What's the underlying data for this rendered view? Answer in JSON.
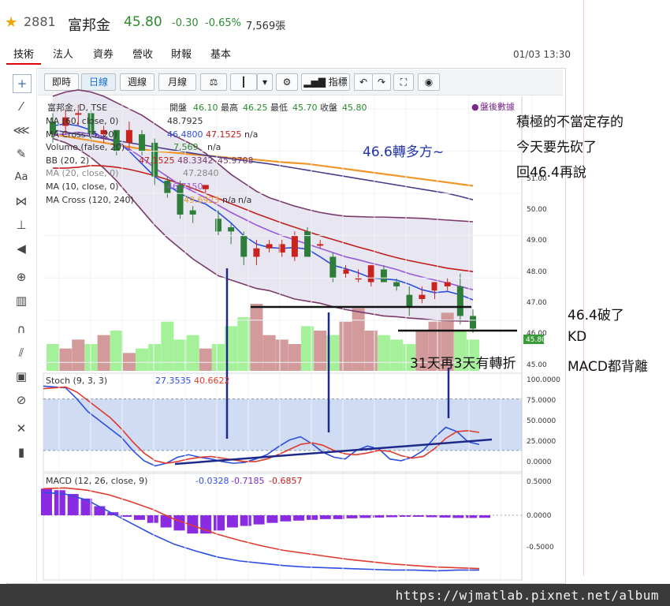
{
  "header": {
    "stock_code": "2881",
    "stock_name": "富邦金",
    "price": "45.80",
    "change": "-0.30",
    "change_pct": "-0.65%",
    "volume": "7,569張",
    "price_color": "#2e8b2e"
  },
  "tabs": [
    {
      "label": "技術",
      "active": true
    },
    {
      "label": "法人"
    },
    {
      "label": "資券"
    },
    {
      "label": "營收"
    },
    {
      "label": "財報"
    },
    {
      "label": "基本"
    }
  ],
  "timestamp": "01/03 13:30",
  "toolbar": {
    "realtime": "即時",
    "daily": "日線",
    "weekly": "週線",
    "monthly": "月線",
    "indicators": "指標"
  },
  "left_tools": [
    "crosshair-icon",
    "trend-line-icon",
    "fib-icon",
    "brush-icon",
    "text-icon",
    "pattern-icon",
    "measure-icon",
    "arrow-left-icon",
    "zoom-icon",
    "bars-icon",
    "magnet-icon",
    "ruler-icon",
    "lock-icon",
    "eye-off-icon",
    "wrench-icon",
    "trash-icon"
  ],
  "legend": {
    "main": {
      "name": "富邦金, D, TSE",
      "open_label": "開盤",
      "open": "46.10",
      "high_label": "最高",
      "high": "46.25",
      "low_label": "最低",
      "low": "45.70",
      "close_label": "收盤",
      "close": "45.80"
    },
    "after_hours": "盤後數據",
    "ma60": {
      "name": "MA (60, close, 0)",
      "value": "48.7925"
    },
    "macross520": {
      "name": "MA Cross (5, 20)",
      "v1": "46.4800",
      "v2": "47.1525",
      "v3": "n/a"
    },
    "volume": {
      "name": "Volume (false, 20)",
      "v1": "7,569",
      "v2": "n/a"
    },
    "bb": {
      "name": "BB (20, 2)",
      "v1": "47.1525",
      "v2": "48.3342",
      "v3": "45.9708"
    },
    "ma20": {
      "name": "MA (20, close, 0)",
      "value": "47.2840"
    },
    "ma10": {
      "name": "MA (10, close, 0)",
      "value": "46.7150"
    },
    "macross120240": {
      "name": "MA Cross (120, 240)",
      "v1": "49.6923",
      "v2": "n/a",
      "v3": "n/a"
    },
    "stoch": {
      "name": "Stoch (9, 3, 3)",
      "v1": "27.3535",
      "v2": "40.6622"
    },
    "macd": {
      "name": "MACD (12, 26, close, 9)",
      "v1": "-0.0328",
      "v2": "-0.7185",
      "v3": "-0.6857"
    }
  },
  "price_axis": {
    "ticks": [
      "51.00",
      "50.00",
      "49.00",
      "48.00",
      "47.00",
      "46.00",
      "45.00"
    ],
    "last_price_tag": "45.80"
  },
  "stoch_axis": {
    "ticks": [
      "100.0000",
      "75.0000",
      "50.0000",
      "25.0000",
      "0.0000"
    ]
  },
  "macd_axis": {
    "ticks": [
      "0.5000",
      "0.0000",
      "-0.5000"
    ]
  },
  "annotations": {
    "note1": "積極的不當定存的",
    "note2": "今天要先砍了",
    "note3": "回46.4再說",
    "bullish": "46.6轉多方~",
    "broken": "46.4破了",
    "kd": "KD",
    "macd_div": "MACD都背離",
    "turn": "31天再3天有轉折"
  },
  "footer_url": "https://wjmatlab.pixnet.net/album",
  "chart_data": [
    {
      "type": "candlestick",
      "title": "富邦金, D, TSE",
      "ylim": [
        44.8,
        51.3
      ],
      "candles": [
        {
          "o": 50.7,
          "h": 50.9,
          "l": 50.2,
          "c": 50.4
        },
        {
          "o": 50.6,
          "h": 51.0,
          "l": 50.4,
          "c": 50.8
        },
        {
          "o": 50.9,
          "h": 51.1,
          "l": 50.6,
          "c": 50.9
        },
        {
          "o": 50.9,
          "h": 51.0,
          "l": 50.2,
          "c": 50.4
        },
        {
          "o": 50.4,
          "h": 50.6,
          "l": 50.2,
          "c": 50.5
        },
        {
          "o": 50.5,
          "h": 50.5,
          "l": 49.9,
          "c": 50.0
        },
        {
          "o": 50.2,
          "h": 50.7,
          "l": 50.0,
          "c": 50.5
        },
        {
          "o": 50.4,
          "h": 50.5,
          "l": 49.9,
          "c": 50.0
        },
        {
          "o": 50.2,
          "h": 50.3,
          "l": 49.2,
          "c": 49.4
        },
        {
          "o": 49.3,
          "h": 49.4,
          "l": 48.9,
          "c": 49.0
        },
        {
          "o": 49.2,
          "h": 49.3,
          "l": 48.4,
          "c": 48.5
        },
        {
          "o": 48.6,
          "h": 48.7,
          "l": 48.3,
          "c": 48.5
        },
        {
          "o": 49.1,
          "h": 49.2,
          "l": 49.0,
          "c": 49.2
        },
        {
          "o": 48.4,
          "h": 48.6,
          "l": 48.0,
          "c": 48.1
        },
        {
          "o": 48.2,
          "h": 48.3,
          "l": 47.8,
          "c": 48.1
        },
        {
          "o": 48.0,
          "h": 48.1,
          "l": 47.3,
          "c": 47.5
        },
        {
          "o": 47.5,
          "h": 47.9,
          "l": 47.3,
          "c": 47.7
        },
        {
          "o": 47.7,
          "h": 47.9,
          "l": 47.6,
          "c": 47.8
        },
        {
          "o": 47.6,
          "h": 47.9,
          "l": 47.5,
          "c": 47.8
        },
        {
          "o": 47.5,
          "h": 48.1,
          "l": 47.4,
          "c": 48.0
        },
        {
          "o": 48.1,
          "h": 48.2,
          "l": 47.5,
          "c": 47.5
        },
        {
          "o": 47.8,
          "h": 47.9,
          "l": 47.7,
          "c": 47.8
        },
        {
          "o": 47.5,
          "h": 47.6,
          "l": 46.9,
          "c": 47.0
        },
        {
          "o": 47.1,
          "h": 47.3,
          "l": 47.0,
          "c": 47.2
        },
        {
          "o": 47.0,
          "h": 47.2,
          "l": 46.9,
          "c": 47.0
        },
        {
          "o": 46.9,
          "h": 47.3,
          "l": 46.8,
          "c": 47.3
        },
        {
          "o": 47.2,
          "h": 47.3,
          "l": 46.9,
          "c": 46.9
        },
        {
          "o": 46.9,
          "h": 47.0,
          "l": 46.7,
          "c": 46.8
        },
        {
          "o": 46.6,
          "h": 46.8,
          "l": 46.1,
          "c": 46.3
        },
        {
          "o": 46.5,
          "h": 46.8,
          "l": 46.4,
          "c": 46.6
        },
        {
          "o": 46.7,
          "h": 46.9,
          "l": 46.5,
          "c": 46.9
        },
        {
          "o": 46.8,
          "h": 47.0,
          "l": 46.7,
          "c": 46.9
        },
        {
          "o": 46.8,
          "h": 47.1,
          "l": 45.9,
          "c": 46.1
        },
        {
          "o": 46.1,
          "h": 46.25,
          "l": 45.7,
          "c": 45.8
        }
      ],
      "series": [
        {
          "name": "MA (60, close, 0)",
          "color": "#f0962a",
          "values": [
            50.4,
            50.35,
            50.3,
            50.25,
            50.2,
            50.15,
            50.1,
            50.05,
            50.0,
            49.98,
            49.95,
            49.92,
            49.9,
            49.87,
            49.84,
            49.82,
            49.8,
            49.77,
            49.74,
            49.72,
            49.7,
            49.66,
            49.62,
            49.58,
            49.54,
            49.5,
            49.46,
            49.42,
            49.38,
            49.34,
            49.3,
            49.26,
            49.22,
            49.18
          ]
        },
        {
          "name": "BB (20, 2)",
          "color": "#7a3b6b",
          "values": [
            51.3,
            51.4,
            51.45,
            51.4,
            51.3,
            51.15,
            51.0,
            50.85,
            50.65,
            50.45,
            50.3,
            50.15,
            49.95,
            49.7,
            49.45,
            49.25,
            49.05,
            48.9,
            48.8,
            48.7,
            48.62,
            48.55,
            48.5,
            48.46,
            48.45,
            48.44,
            48.44,
            48.43,
            48.42,
            48.41,
            48.39,
            48.37,
            48.35,
            48.33
          ]
        },
        {
          "name": "BB (20, 2)",
          "color": "#7a3b6b",
          "values": [
            50.3,
            50.2,
            50.05,
            49.85,
            49.6,
            49.3,
            48.95,
            48.6,
            48.25,
            47.95,
            47.7,
            47.45,
            47.25,
            47.05,
            46.95,
            46.85,
            46.75,
            46.7,
            46.6,
            46.5,
            46.45,
            46.4,
            46.32,
            46.25,
            46.2,
            46.15,
            46.1,
            46.08,
            46.05,
            46.03,
            46.0,
            45.99,
            45.98,
            45.97
          ]
        },
        {
          "name": "MA Cross (5, 20)",
          "color": "#c0201e",
          "values": [
            49.6,
            49.6,
            49.62,
            49.66,
            49.65,
            49.62,
            49.57,
            49.5,
            49.42,
            49.33,
            49.23,
            49.12,
            49.0,
            48.88,
            48.76,
            48.64,
            48.52,
            48.41,
            48.3,
            48.2,
            48.1,
            48.0,
            47.91,
            47.82,
            47.73,
            47.65,
            47.56,
            47.48,
            47.41,
            47.35,
            47.29,
            47.23,
            47.19,
            47.15
          ]
        },
        {
          "name": "MA Cross (5, 20)",
          "color": "#2d4ee0",
          "values": [
            50.6,
            50.65,
            50.6,
            50.5,
            50.3,
            50.25,
            50.0,
            49.7,
            49.4,
            49.2,
            49.0,
            48.85,
            48.75,
            48.55,
            48.3,
            48.0,
            47.8,
            47.72,
            47.7,
            47.72,
            47.68,
            47.5,
            47.3,
            47.22,
            47.12,
            47.0,
            46.98,
            46.95,
            46.85,
            46.72,
            46.65,
            46.68,
            46.6,
            46.48
          ]
        },
        {
          "name": "MA (10, close, 0)",
          "color": "#9a5ad6",
          "values": [
            50.4,
            50.4,
            50.45,
            50.4,
            50.35,
            50.2,
            50.05,
            49.85,
            49.6,
            49.4,
            49.2,
            49.05,
            48.9,
            48.72,
            48.55,
            48.4,
            48.25,
            48.12,
            48.0,
            47.9,
            47.8,
            47.7,
            47.6,
            47.5,
            47.43,
            47.35,
            47.28,
            47.2,
            47.1,
            47.02,
            46.95,
            46.88,
            46.8,
            46.72
          ]
        },
        {
          "name": "MA Cross (120, 240)",
          "color": "#4a3f8a",
          "values": [
            50.5,
            50.45,
            50.4,
            50.35,
            50.3,
            50.25,
            50.2,
            50.15,
            50.1,
            50.05,
            50.0,
            49.95,
            49.9,
            49.86,
            49.82,
            49.78,
            49.74,
            49.7,
            49.65,
            49.6,
            49.55,
            49.5,
            49.45,
            49.4,
            49.35,
            49.3,
            49.25,
            49.2,
            49.15,
            49.1,
            49.05,
            49.0,
            48.93,
            48.85
          ]
        }
      ],
      "volume": {
        "name": "Volume (false, 20)",
        "values": [
          30,
          25,
          35,
          30,
          40,
          45,
          20,
          25,
          30,
          55,
          35,
          40,
          25,
          30,
          50,
          60,
          75,
          40,
          35,
          30,
          50,
          45,
          40,
          55,
          70,
          45,
          40,
          35,
          30,
          45,
          55,
          65,
          45,
          35
        ],
        "up_color": "#9bf08f",
        "down_color": "#cd8f8f"
      }
    },
    {
      "type": "line",
      "title": "Stoch (9, 3, 3)",
      "ylim": [
        -5,
        110
      ],
      "series": [
        {
          "name": "Stoch %K",
          "color": "#2d4ee0",
          "values": [
            95,
            94,
            93,
            80,
            65,
            55,
            45,
            35,
            20,
            8,
            2,
            5,
            12,
            15,
            12,
            10,
            7,
            5,
            6,
            10,
            15,
            24,
            32,
            36,
            28,
            18,
            12,
            10,
            20,
            25,
            22,
            10,
            8,
            12,
            20,
            35,
            47,
            42,
            30,
            27
          ]
        },
        {
          "name": "Stoch %D",
          "color": "#e03b2e",
          "values": [
            92,
            93,
            94,
            88,
            78,
            68,
            58,
            45,
            30,
            17,
            8,
            5,
            7,
            10,
            12,
            13,
            11,
            9,
            7,
            7,
            10,
            15,
            21,
            27,
            29,
            26,
            20,
            16,
            15,
            17,
            20,
            19,
            14,
            11,
            13,
            22,
            34,
            42,
            43,
            41
          ]
        }
      ]
    },
    {
      "type": "bar",
      "title": "MACD (12, 26, close, 9)",
      "ylim": [
        -0.85,
        0.55
      ],
      "histogram": [
        0.35,
        0.33,
        0.28,
        0.22,
        0.12,
        0.04,
        -0.02,
        -0.06,
        -0.1,
        -0.16,
        -0.2,
        -0.24,
        -0.24,
        -0.2,
        -0.16,
        -0.14,
        -0.12,
        -0.1,
        -0.08,
        -0.07,
        -0.06,
        -0.05,
        -0.05,
        -0.04,
        -0.035,
        -0.03,
        -0.025,
        -0.02,
        -0.02,
        -0.025,
        -0.03,
        -0.035,
        -0.035,
        -0.033
      ],
      "series": [
        {
          "name": "MACD",
          "color": "#2d4ee0",
          "values": [
            0.3,
            0.28,
            0.2,
            0.05,
            -0.1,
            -0.25,
            -0.38,
            -0.47,
            -0.55,
            -0.6,
            -0.63,
            -0.66,
            -0.68,
            -0.69,
            -0.7,
            -0.71,
            -0.72,
            -0.72,
            -0.73,
            -0.72,
            -0.72
          ]
        },
        {
          "name": "Signal",
          "color": "#e03b2e",
          "values": [
            0.35,
            0.36,
            0.33,
            0.27,
            0.18,
            0.08,
            -0.05,
            -0.15,
            -0.25,
            -0.33,
            -0.4,
            -0.46,
            -0.5,
            -0.54,
            -0.58,
            -0.61,
            -0.64,
            -0.66,
            -0.68,
            -0.69,
            -0.7
          ]
        }
      ]
    }
  ]
}
